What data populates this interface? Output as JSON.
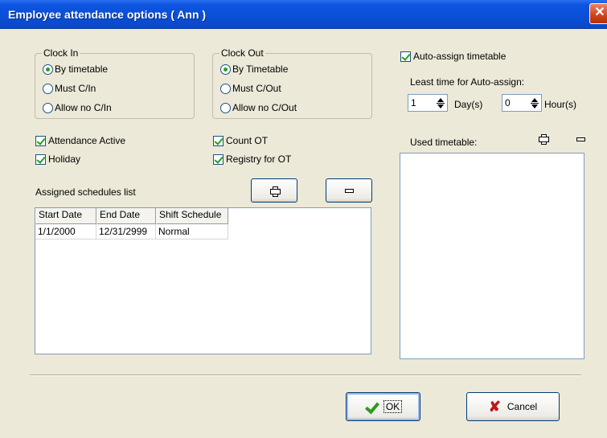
{
  "window": {
    "title": "Employee attendance options ( Ann )",
    "close_glyph": "✕"
  },
  "clock_in": {
    "legend": "Clock In",
    "options": [
      {
        "label": "By timetable",
        "checked": true
      },
      {
        "label": "Must C/In",
        "checked": false
      },
      {
        "label": "Allow no C/In",
        "checked": false
      }
    ]
  },
  "clock_out": {
    "legend": "Clock Out",
    "options": [
      {
        "label": "By Timetable",
        "checked": true
      },
      {
        "label": "Must C/Out",
        "checked": false
      },
      {
        "label": "Allow no C/Out",
        "checked": false
      }
    ]
  },
  "checkboxes": {
    "attendance_active": {
      "label": "Attendance Active",
      "checked": true
    },
    "holiday": {
      "label": "Holiday",
      "checked": true
    },
    "count_ot": {
      "label": "Count OT",
      "checked": true
    },
    "registry_ot": {
      "label": "Registry for OT",
      "checked": true
    }
  },
  "schedules": {
    "label": "Assigned schedules list",
    "columns": [
      "Start Date",
      "End Date",
      "Shift Schedule"
    ],
    "rows": [
      [
        "1/1/2000",
        "12/31/2999",
        "Normal"
      ]
    ]
  },
  "auto_assign": {
    "label": "Auto-assign timetable",
    "checked": true,
    "least_time_label": "Least time for Auto-assign:",
    "days_value": "1",
    "days_unit": "Day(s)",
    "hours_value": "0",
    "hours_unit": "Hour(s)"
  },
  "used_timetable": {
    "label": "Used timetable:"
  },
  "buttons": {
    "ok": "OK",
    "cancel": "Cancel"
  },
  "icons": {
    "add": "plus-icon",
    "remove": "minus-icon",
    "ok": "checkmark-icon",
    "cancel": "red-x-icon"
  },
  "colors": {
    "titlebar": "#0a4fd6",
    "close_button": "#d0421c",
    "dialog_background": "#ece9d8",
    "check_green": "#21a121",
    "cancel_red": "#c0171b"
  }
}
